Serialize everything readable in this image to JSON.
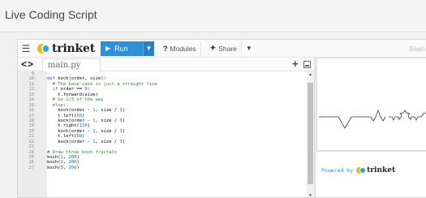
{
  "page": {
    "title": "Live Coding Script"
  },
  "toolbar": {
    "menu_icon": "hamburger-icon",
    "logo_text": "trinket",
    "run_label": "Run",
    "modules_label": "Modules",
    "share_label": "Share",
    "save_label": "Savin"
  },
  "editor": {
    "filename": "main.py",
    "lines": [
      {
        "n": "9",
        "fold": "",
        "html": ""
      },
      {
        "n": "10",
        "fold": "-",
        "text": "def koch(order, size):"
      },
      {
        "n": "11",
        "fold": "",
        "text": "  # The base case is just a straight line"
      },
      {
        "n": "12",
        "fold": "-",
        "text": "  if order == 0:"
      },
      {
        "n": "13",
        "fold": "",
        "text": "    t.forward(size)"
      },
      {
        "n": "14",
        "fold": "",
        "text": "  # Go 1/3 of the way"
      },
      {
        "n": "15",
        "fold": "-",
        "text": "  else:"
      },
      {
        "n": "16",
        "fold": "",
        "text": "    koch(order - 1, size / 3)"
      },
      {
        "n": "17",
        "fold": "",
        "text": "    t.left(60)"
      },
      {
        "n": "18",
        "fold": "",
        "text": "    koch(order - 1, size / 3)"
      },
      {
        "n": "19",
        "fold": "",
        "text": "    t.right(120)"
      },
      {
        "n": "20",
        "fold": "",
        "text": "    koch(order - 1, size / 3)"
      },
      {
        "n": "21",
        "fold": "",
        "text": "    t.left(60)"
      },
      {
        "n": "22",
        "fold": "",
        "text": "    koch(order - 1, size / 3)"
      },
      {
        "n": "23",
        "fold": "",
        "text": ""
      },
      {
        "n": "24",
        "fold": "",
        "text": "# Draw three koch fractals"
      },
      {
        "n": "25",
        "fold": "",
        "text": "koch(1, 200)"
      },
      {
        "n": "26",
        "fold": "",
        "text": "koch(2, 200)"
      },
      {
        "n": "27",
        "fold": "",
        "text": "koch(3, 200)"
      }
    ]
  },
  "output": {
    "powered_by": "Powered by",
    "powered_brand": "trinket"
  },
  "colors": {
    "run_button": "#2f8fd8",
    "logo_yellow": "#f3b911",
    "logo_blue": "#23a9e1"
  }
}
